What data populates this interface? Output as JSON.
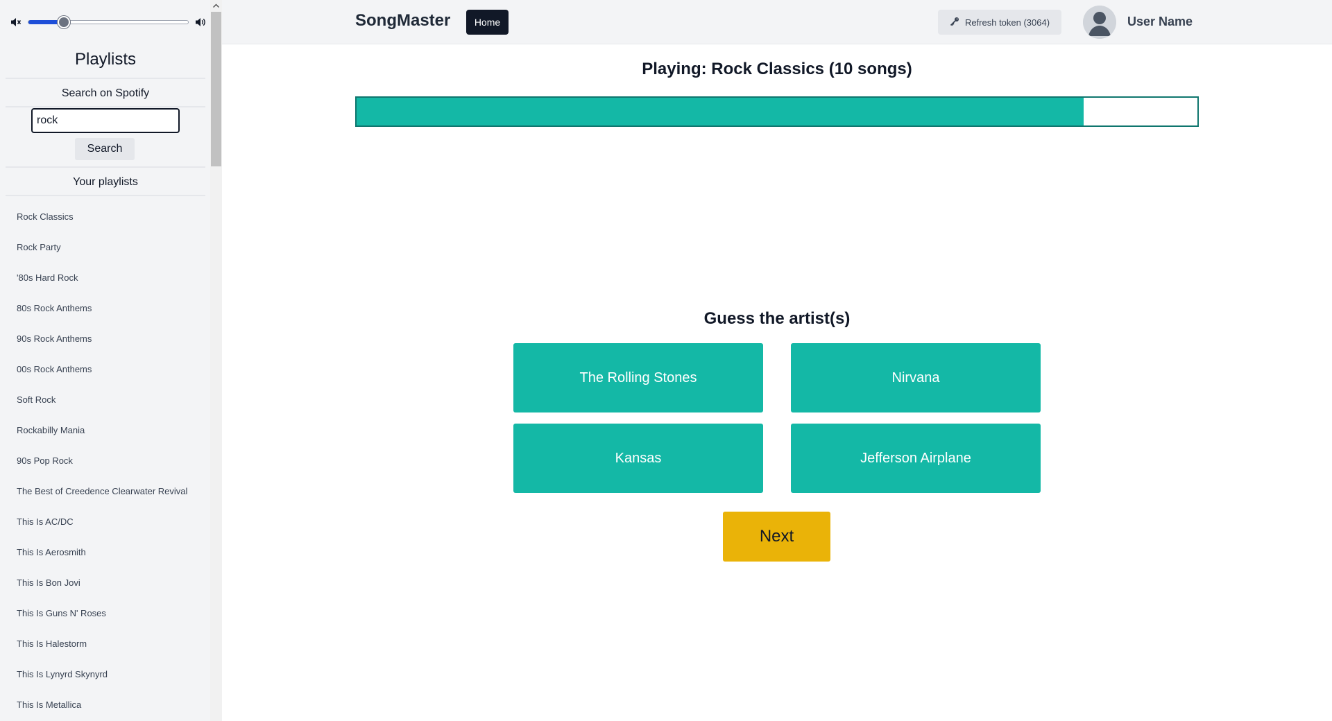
{
  "sidebar": {
    "volume": {
      "mute_icon": "speaker-mute-icon",
      "max_icon": "speaker-loud-icon",
      "level": 0.22
    },
    "title": "Playlists",
    "search_heading": "Search on Spotify",
    "search_value": "rock",
    "search_button": "Search",
    "your_playlists_heading": "Your playlists",
    "playlists": [
      "Rock Classics",
      "Rock Party",
      "'80s Hard Rock",
      "80s Rock Anthems",
      "90s Rock Anthems",
      "00s Rock Anthems",
      "Soft Rock",
      "Rockabilly Mania",
      "90s Pop Rock",
      "The Best of Creedence Clearwater Revival",
      "This Is AC/DC",
      "This Is Aerosmith",
      "This Is Bon Jovi",
      "This Is Guns N' Roses",
      "This Is Halestorm",
      "This Is Lynyrd Skynyrd",
      "This Is Metallica"
    ]
  },
  "header": {
    "brand": "SongMaster",
    "home_button": "Home",
    "refresh_button": "Refresh token (3064)",
    "refresh_icon": "key-icon",
    "user_name": "User Name",
    "avatar_icon": "user-silhouette-icon"
  },
  "main": {
    "playing_title": "Playing: Rock Classics (10 songs)",
    "progress": 0.865,
    "guess_title": "Guess the artist(s)",
    "answers": [
      "The Rolling Stones",
      "Nirvana",
      "Kansas",
      "Jefferson Airplane"
    ],
    "next_button": "Next"
  },
  "colors": {
    "accent_teal": "#14b8a6",
    "progress_border": "#0f766e",
    "next_yellow": "#eab308",
    "home_dark": "#111827",
    "sidebar_bg": "#f3f4f6"
  }
}
